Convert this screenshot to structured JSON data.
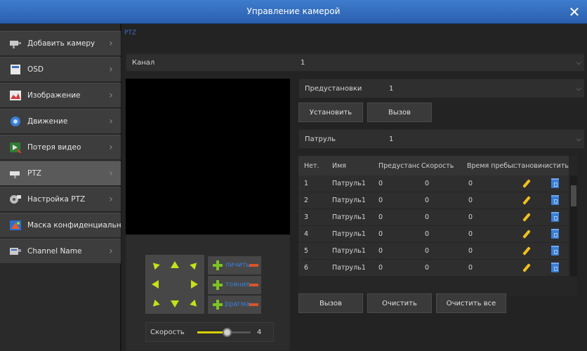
{
  "window": {
    "title": "Управление камерой",
    "close": "✕"
  },
  "breadcrumb": "PTZ",
  "sidebar": {
    "items": [
      {
        "label": "Добавить камеру",
        "icon": "add-camera-icon"
      },
      {
        "label": "OSD",
        "icon": "osd-icon"
      },
      {
        "label": "Изображение",
        "icon": "image-icon"
      },
      {
        "label": "Движение",
        "icon": "motion-icon"
      },
      {
        "label": "Потеря видео",
        "icon": "video-loss-icon"
      },
      {
        "label": "PTZ",
        "icon": "ptz-camera-icon",
        "active": true
      },
      {
        "label": "Настройка PTZ",
        "icon": "ptz-setup-icon"
      },
      {
        "label": "Маска конфиденциальности",
        "icon": "privacy-mask-icon"
      },
      {
        "label": "Channel Name",
        "icon": "channel-name-icon"
      }
    ]
  },
  "channel": {
    "label": "Канал",
    "value": "1"
  },
  "presets": {
    "label": "Предустановки",
    "value": "1"
  },
  "buttons": {
    "set": "Установить",
    "call": "Вызов"
  },
  "patrol": {
    "label": "Патруль",
    "value": "1"
  },
  "table": {
    "headers": [
      "Нет.",
      "Имя",
      "Предустано",
      "Скорость",
      "Время пребыв",
      "Установи",
      "Очистить"
    ],
    "rows": [
      [
        "1",
        "Патруль1",
        "0",
        "0",
        "0"
      ],
      [
        "2",
        "Патруль1",
        "0",
        "0",
        "0"
      ],
      [
        "3",
        "Патруль1",
        "0",
        "0",
        "0"
      ],
      [
        "4",
        "Патруль1",
        "0",
        "0",
        "0"
      ],
      [
        "5",
        "Патруль1",
        "0",
        "0",
        "0"
      ],
      [
        "6",
        "Патруль1",
        "0",
        "0",
        "0"
      ]
    ]
  },
  "bottom_buttons": {
    "call": "Вызов",
    "clear": "Очистить",
    "clear_all": "Очистить все"
  },
  "ptz": {
    "zoom_label": "Увеличить",
    "focus_label": "Фокусное расстояние",
    "iris_label": "Диафрагма",
    "speed_label": "Скорость",
    "speed_value": "4",
    "speed_fraction": 0.57
  },
  "colors": {
    "titlebar": "#2f6bbd",
    "arrow": "#c6e11a",
    "plus": "#7cc321",
    "minus": "#d8542a",
    "edit": "#f0c020",
    "delete": "#3a7fd8",
    "slider": "#d7d000"
  }
}
